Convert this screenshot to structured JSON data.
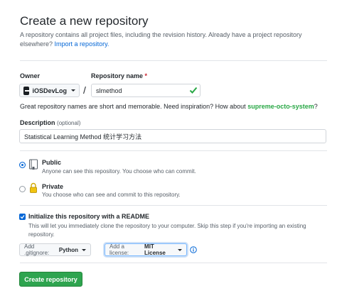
{
  "header": {
    "title": "Create a new repository",
    "subtitle_text": "A repository contains all project files, including the revision history. Already have a project repository elsewhere?",
    "import_link": "Import a repository."
  },
  "owner": {
    "label": "Owner",
    "value": "iOSDevLog"
  },
  "repo": {
    "label": "Repository name",
    "required_mark": "*",
    "separator": "/",
    "value": "slmethod"
  },
  "hint": {
    "text": "Great repository names are short and memorable. Need inspiration? How about",
    "suggestion": "supreme-octo-system",
    "suffix": "?"
  },
  "description": {
    "label": "Description",
    "optional": "(optional)",
    "value": "Statistical Learning Method 统计学习方法"
  },
  "visibility": {
    "public": {
      "title": "Public",
      "desc": "Anyone can see this repository. You choose who can commit.",
      "selected": true
    },
    "private": {
      "title": "Private",
      "desc": "You choose who can see and commit to this repository.",
      "selected": false
    }
  },
  "init": {
    "checked": true,
    "title": "Initialize this repository with a README",
    "desc": "This will let you immediately clone the repository to your computer. Skip this step if you're importing an existing repository."
  },
  "gitignore": {
    "label": "Add .gitignore:",
    "value": "Python"
  },
  "license": {
    "label": "Add a license:",
    "value": "MIT License"
  },
  "submit": {
    "label": "Create repository"
  },
  "colors": {
    "accent": "#0366d6",
    "success": "#2ea44f",
    "suggestion": "#28a745",
    "required": "#cb2431"
  }
}
